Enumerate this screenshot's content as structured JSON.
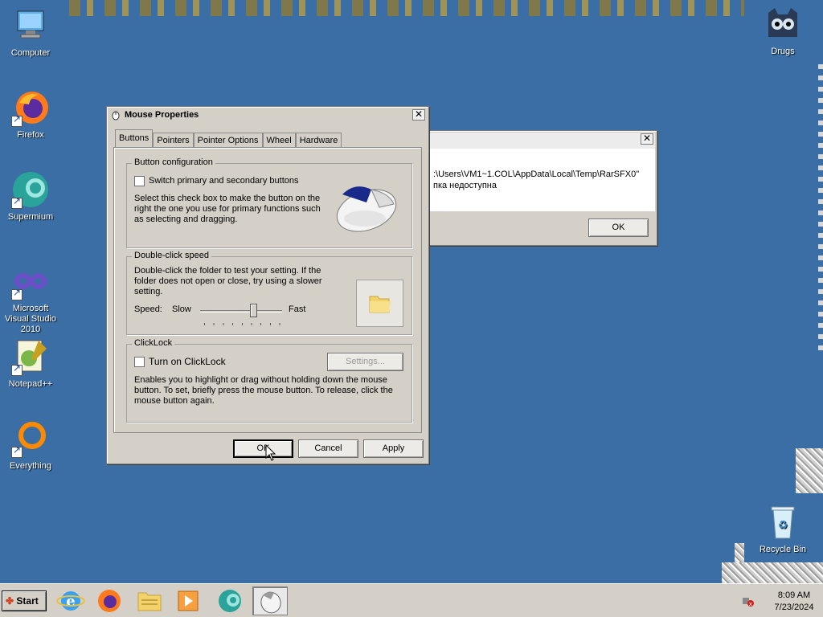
{
  "desktop": {
    "icons_left": [
      {
        "label": "Computer"
      },
      {
        "label": "Firefox"
      },
      {
        "label": "Supermium"
      },
      {
        "label": "Microsoft Visual Studio 2010"
      },
      {
        "label": "Notepad++"
      },
      {
        "label": "Everything"
      }
    ],
    "icons_right": [
      {
        "label": "Drugs"
      },
      {
        "label": "Recycle Bin"
      }
    ]
  },
  "error_dialog": {
    "message_line1": ":\\Users\\VM1~1.COL\\AppData\\Local\\Temp\\RarSFX0\"",
    "message_line2": "пка недоступна",
    "ok_label": "OK"
  },
  "mouse_properties": {
    "title": "Mouse Properties",
    "tabs": [
      {
        "label": "Buttons"
      },
      {
        "label": "Pointers"
      },
      {
        "label": "Pointer Options"
      },
      {
        "label": "Wheel"
      },
      {
        "label": "Hardware"
      }
    ],
    "button_config": {
      "title": "Button configuration",
      "switch_label": "Switch primary and secondary buttons",
      "switch_checked": false,
      "description": "Select this check box to make the button on the right the one you use for primary functions such as selecting and dragging."
    },
    "double_click": {
      "title": "Double-click speed",
      "description": "Double-click the folder to test your setting. If the folder does not open or close, try using a slower setting.",
      "speed_label": "Speed:",
      "slow_label": "Slow",
      "fast_label": "Fast",
      "speed_value": 0.65
    },
    "clicklock": {
      "title": "ClickLock",
      "turn_on_label": "Turn on ClickLock",
      "turn_on_checked": false,
      "settings_label": "Settings...",
      "description": "Enables you to highlight or drag without holding down the mouse button. To set, briefly press the mouse button. To release, click the mouse button again."
    },
    "ok_label": "OK",
    "cancel_label": "Cancel",
    "apply_label": "Apply"
  },
  "taskbar": {
    "start_label": "Start",
    "time": "8:09 AM",
    "date": "7/23/2024"
  }
}
